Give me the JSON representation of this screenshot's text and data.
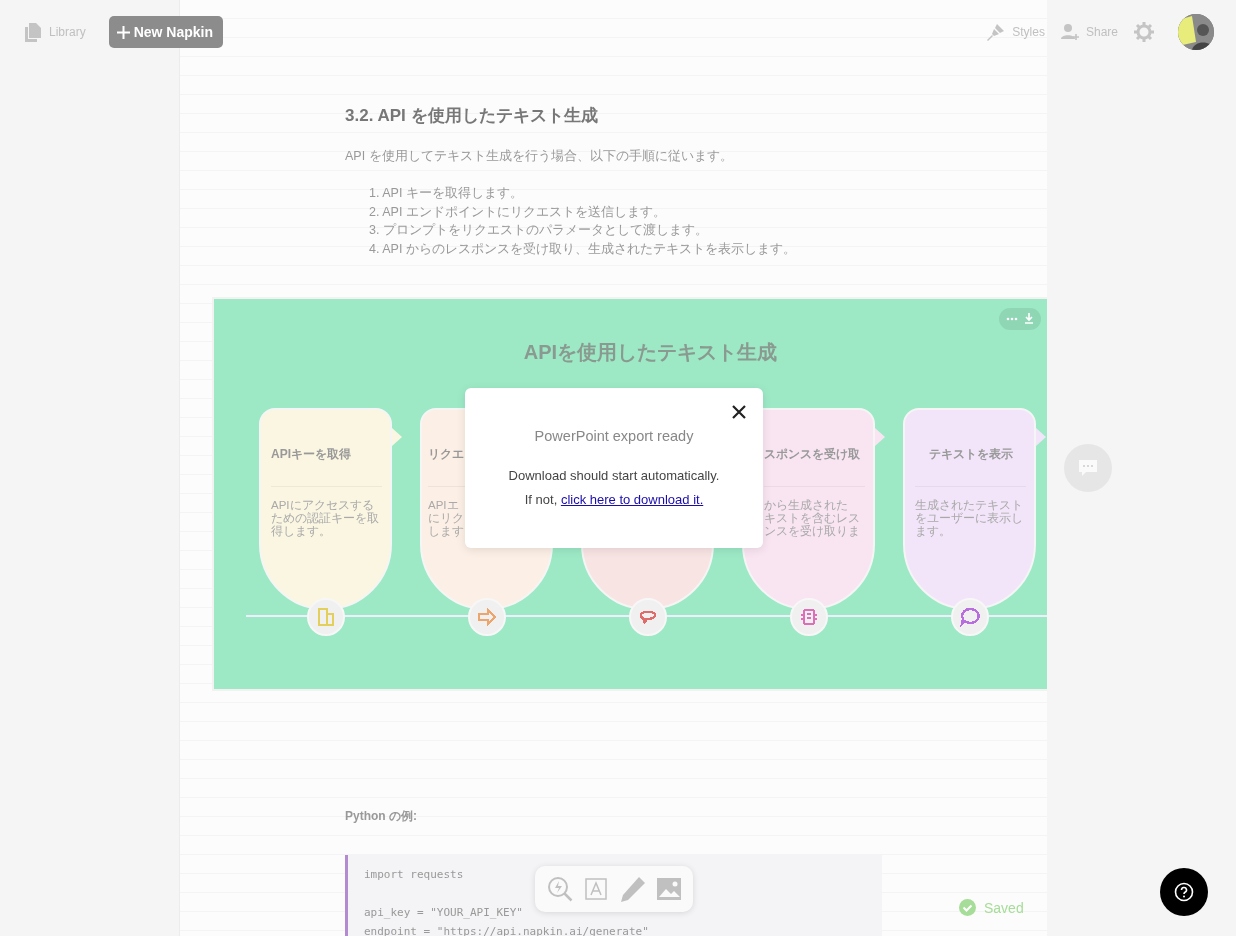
{
  "header": {
    "library": "Library",
    "new_button": "New Napkin",
    "styles": "Styles",
    "share": "Share"
  },
  "document": {
    "heading": "3.2. API を使用したテキスト生成",
    "intro": "API を使用してテキスト生成を行う場合、以下の手順に従います。",
    "steps": [
      "1. API キーを取得します。",
      "2. API エンドポイントにリクエストを送信します。",
      "3. プロンプトをリクエストのパラメータとして渡します。",
      "4. API からのレスポンスを受け取り、生成されたテキストを表示します。"
    ],
    "diagram": {
      "title": "APIを使用したテキスト生成",
      "cards": [
        {
          "kind": "key",
          "color": "#e3cf5c",
          "title": "APIキーを取得",
          "body_lines": [
            "APIにアクセスする",
            "ための認証キーを取",
            "得します。"
          ]
        },
        {
          "kind": "arrow",
          "color": "#eda56e",
          "title": "リクエ",
          "body_lines": [
            "APIエ",
            "にリク",
            "します"
          ]
        },
        {
          "kind": "chat",
          "color": "#e06b6b"
        },
        {
          "kind": "robot",
          "color": "#dd6fb8",
          "title": "スポンスを受け取",
          "body_lines": [
            "から生成された",
            "キストを含むレス",
            "ンスを受け取りま"
          ]
        },
        {
          "kind": "sms",
          "color": "#b96ee0",
          "title": "テキストを表示",
          "body_lines": [
            "生成されたテキスト",
            "をユーザーに表示し",
            "ます。"
          ]
        }
      ]
    },
    "example_label": "Python の例:",
    "code_groups": [
      [
        "import requests"
      ],
      [
        "api_key = \"YOUR_API_KEY\"",
        "endpoint = \"https://api.napkin.ai/generate\""
      ]
    ]
  },
  "status": "Saved",
  "modal": {
    "title": "PowerPoint export ready",
    "line1": "Download should start automatically.",
    "prefix": "If not,",
    "link": "click here to download it."
  }
}
